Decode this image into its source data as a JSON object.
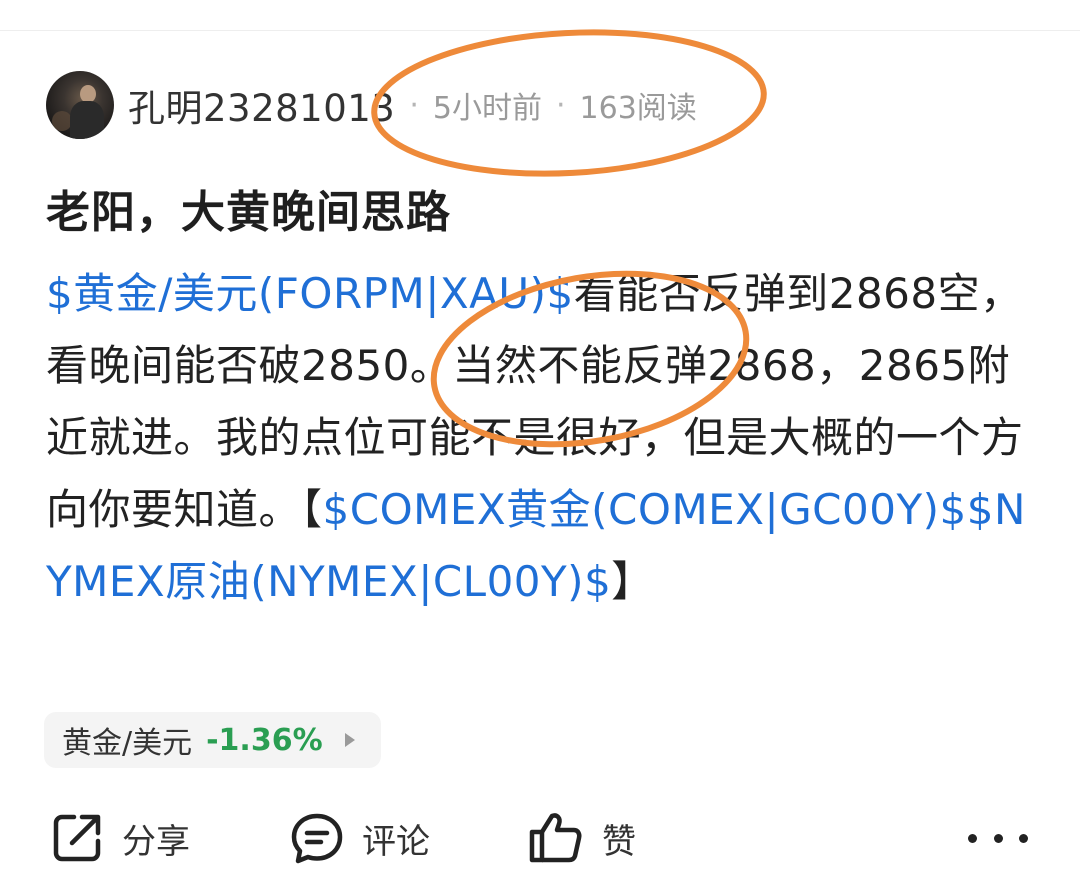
{
  "post": {
    "author": "孔明23281013",
    "time_ago": "5小时前",
    "read_count": "163阅读",
    "separator": "·",
    "title": "老阳，大黄晚间思路",
    "content": {
      "tag_gold_usd": "$黄金/美元(FORPM|XAU)$",
      "text1": "看能否反弹到2868空，看晚间能否破2850。当然不能反弹2868，2865附近就进。我的点位可能不是很好，但是大概的一个方向你要知道。【",
      "tag_comex_gold": "$COMEX黄金(COMEX|GC00Y)$",
      "tag_nymex_oil": "$NYMEX原油(NYMEX|CL00Y)$",
      "text2": "】"
    }
  },
  "stock_chip": {
    "name": "黄金/美元",
    "change": "-1.36%",
    "change_color": "#2a9e52"
  },
  "actions": {
    "share": "分享",
    "comment": "评论",
    "like": "赞"
  },
  "colors": {
    "tag": "#1f6fd6",
    "annotation": "#ee8a3a"
  },
  "icons": [
    "share-icon",
    "comment-icon",
    "like-icon",
    "more-icon"
  ]
}
